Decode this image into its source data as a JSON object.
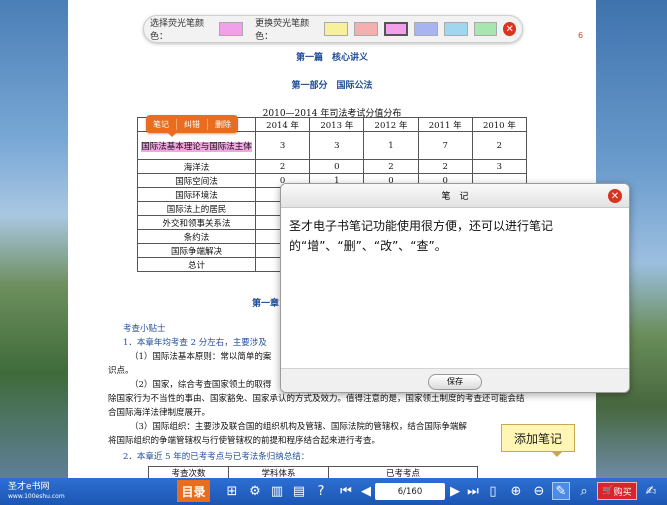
{
  "highlight_toolbar": {
    "select_label": "选择荧光笔颜色：",
    "change_label": "更换荧光笔颜色：",
    "select_color": "#f3a0ea",
    "change_colors": [
      "#f6f19a",
      "#f3b0b0",
      "#f3a0ea",
      "#a8b4f2",
      "#9fd8ee",
      "#a7e6b1"
    ],
    "selected_index": 2
  },
  "page": {
    "page_number": "6",
    "heading1": "第一篇　核心讲义",
    "heading2": "第一部分　国际公法",
    "table_caption": "2010—2014 年司法考试分值分布",
    "table": {
      "headers": [
        "",
        "2014 年",
        "2013 年",
        "2012 年",
        "2011 年",
        "2010 年"
      ],
      "rows": [
        [
          "国际法基本理论与国际法主体",
          "3",
          "3",
          "1",
          "7",
          "2"
        ],
        [
          "海洋法",
          "2",
          "0",
          "2",
          "2",
          "3"
        ],
        [
          "国际空间法",
          "0",
          "1",
          "0",
          "0",
          ""
        ],
        [
          "国际环境法",
          "",
          "",
          "",
          "",
          ""
        ],
        [
          "国际法上的居民",
          "",
          "",
          "",
          "",
          ""
        ],
        [
          "外交和领事关系法",
          "",
          "",
          "",
          "",
          ""
        ],
        [
          "条约法",
          "",
          "",
          "",
          "",
          ""
        ],
        [
          "国际争端解决",
          "",
          "",
          "",
          "",
          ""
        ],
        [
          "总计",
          "",
          "",
          "",
          "",
          ""
        ]
      ]
    },
    "context_menu": [
      "笔记",
      "纠错",
      "删除"
    ],
    "chapter_title": "第一章",
    "tips_title": "考查小贴士",
    "paragraphs": [
      "1．本章年均考查 2 分左右，主要涉及",
      "（1）国际法基本原则：常以简单的案",
      "识点。",
      "（2）国家，综合考查国家领土的取得",
      "除国家行为不当性的事由、国家豁免、国家承认的方式及效力。值得注意的是，国家领土制度的考查还可能会结",
      "合国际海洋法律制度展开。",
      "（3）国际组织：主要涉及联合国的组织机构及管辖、国际法院的管辖权，结合国际争端解",
      "将国际组织的争端管辖权与行使管辖权的前提和程序结合起来进行考查。",
      "2．本章近 5 年的已考考点与已考法条归纳总结："
    ],
    "bottom_table_headers": [
      "考查次数",
      "学科体系",
      "已考考点"
    ]
  },
  "note_dialog": {
    "title": "笔　记",
    "content": "圣才电子书笔记功能使用很方便，还可以进行笔记的“增”、“删”、“改”、“查”。",
    "save_label": "保存"
  },
  "tooltip": "添加笔记",
  "bottom_bar": {
    "brand": "圣才e书网",
    "brand_url": "www.100eshu.com",
    "toc_label": "目录",
    "page_indicator": "6/160",
    "buy_label": "购买"
  }
}
